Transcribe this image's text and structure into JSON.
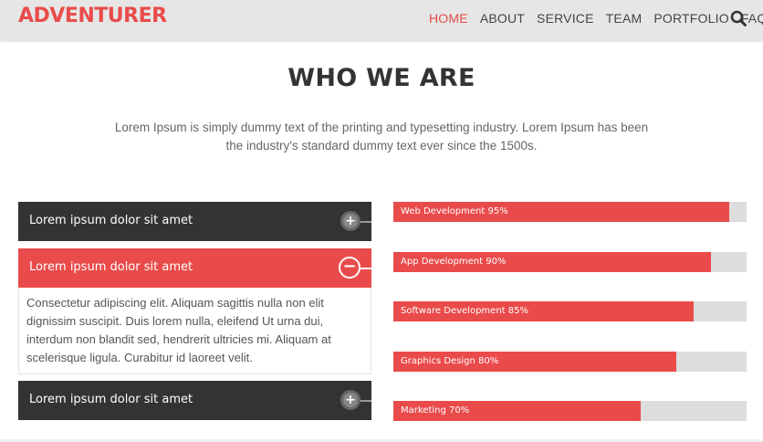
{
  "brand": "ADVENTURER",
  "nav": [
    {
      "label": "HOME",
      "active": true
    },
    {
      "label": "ABOUT",
      "active": false
    },
    {
      "label": "SERVICE",
      "active": false
    },
    {
      "label": "TEAM",
      "active": false
    },
    {
      "label": "PORTFOLIO",
      "active": false
    },
    {
      "label": "FAQ",
      "active": false
    }
  ],
  "section": {
    "title": "WHO WE ARE",
    "intro": "Lorem Ipsum is simply dummy text of the printing and typesetting industry. Lorem Ipsum has been the industry's standard dummy text ever since the 1500s."
  },
  "accordion": [
    {
      "title": "Lorem ipsum dolor sit amet",
      "open": false,
      "icon": "+"
    },
    {
      "title": "Lorem ipsum dolor sit amet",
      "open": true,
      "icon": "−",
      "body": "Consectetur adipiscing elit. Aliquam sagittis nulla non elit dignissim suscipit. Duis lorem nulla, eleifend Ut urna dui, interdum non blandit sed, hendrerit ultricies mi. Aliquam at scelerisque ligula. Curabitur id laoreet velit."
    },
    {
      "title": "Lorem ipsum dolor sit amet",
      "open": false,
      "icon": "+"
    }
  ],
  "skills": [
    {
      "label": "Web Development 95%",
      "percent": 95
    },
    {
      "label": "App Development 90%",
      "percent": 90
    },
    {
      "label": "Software Development 85%",
      "percent": 85
    },
    {
      "label": "Graphics Design 80%",
      "percent": 80
    },
    {
      "label": "Marketing 70%",
      "percent": 70
    }
  ],
  "colors": {
    "accent": "#e94b4b",
    "dark": "#333333",
    "track": "#dddddd"
  }
}
